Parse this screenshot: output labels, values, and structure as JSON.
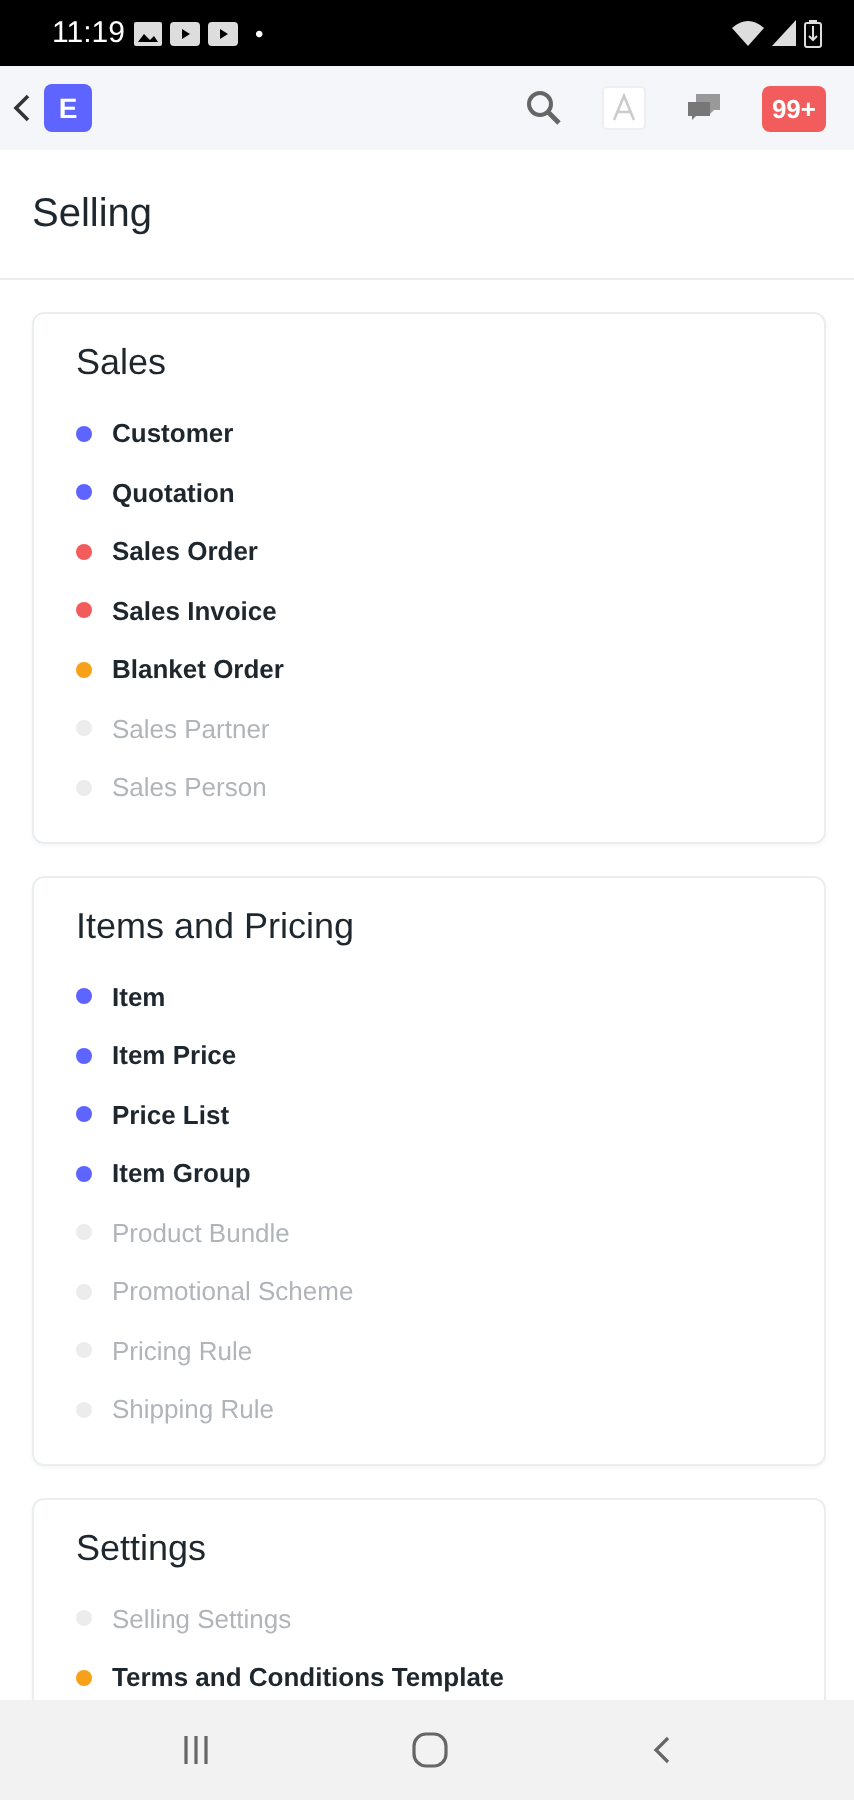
{
  "status_bar": {
    "time": "11:19",
    "dot": "•"
  },
  "app_bar": {
    "logo": "E",
    "notifications": "99+"
  },
  "page": {
    "title": "Selling"
  },
  "cards": [
    {
      "title": "Sales",
      "items": [
        {
          "label": "Customer",
          "available": true,
          "color": "#5e64ff"
        },
        {
          "label": "Quotation",
          "available": true,
          "color": "#5e64ff"
        },
        {
          "label": "Sales Order",
          "available": true,
          "color": "#f25c5c"
        },
        {
          "label": "Sales Invoice",
          "available": true,
          "color": "#f25c5c"
        },
        {
          "label": "Blanket Order",
          "available": true,
          "color": "#f7a01a"
        },
        {
          "label": "Sales Partner",
          "available": false,
          "color": "#ececec"
        },
        {
          "label": "Sales Person",
          "available": false,
          "color": "#ececec"
        }
      ]
    },
    {
      "title": "Items and Pricing",
      "items": [
        {
          "label": "Item",
          "available": true,
          "color": "#5e64ff"
        },
        {
          "label": "Item Price",
          "available": true,
          "color": "#5e64ff"
        },
        {
          "label": "Price List",
          "available": true,
          "color": "#5e64ff"
        },
        {
          "label": "Item Group",
          "available": true,
          "color": "#5e64ff"
        },
        {
          "label": "Product Bundle",
          "available": false,
          "color": "#ececec"
        },
        {
          "label": "Promotional Scheme",
          "available": false,
          "color": "#ececec"
        },
        {
          "label": "Pricing Rule",
          "available": false,
          "color": "#ececec"
        },
        {
          "label": "Shipping Rule",
          "available": false,
          "color": "#ececec"
        }
      ]
    },
    {
      "title": "Settings",
      "items": [
        {
          "label": "Selling Settings",
          "available": false,
          "color": "#ececec"
        },
        {
          "label": "Terms and Conditions Template",
          "available": true,
          "color": "#f7a01a"
        }
      ]
    }
  ]
}
